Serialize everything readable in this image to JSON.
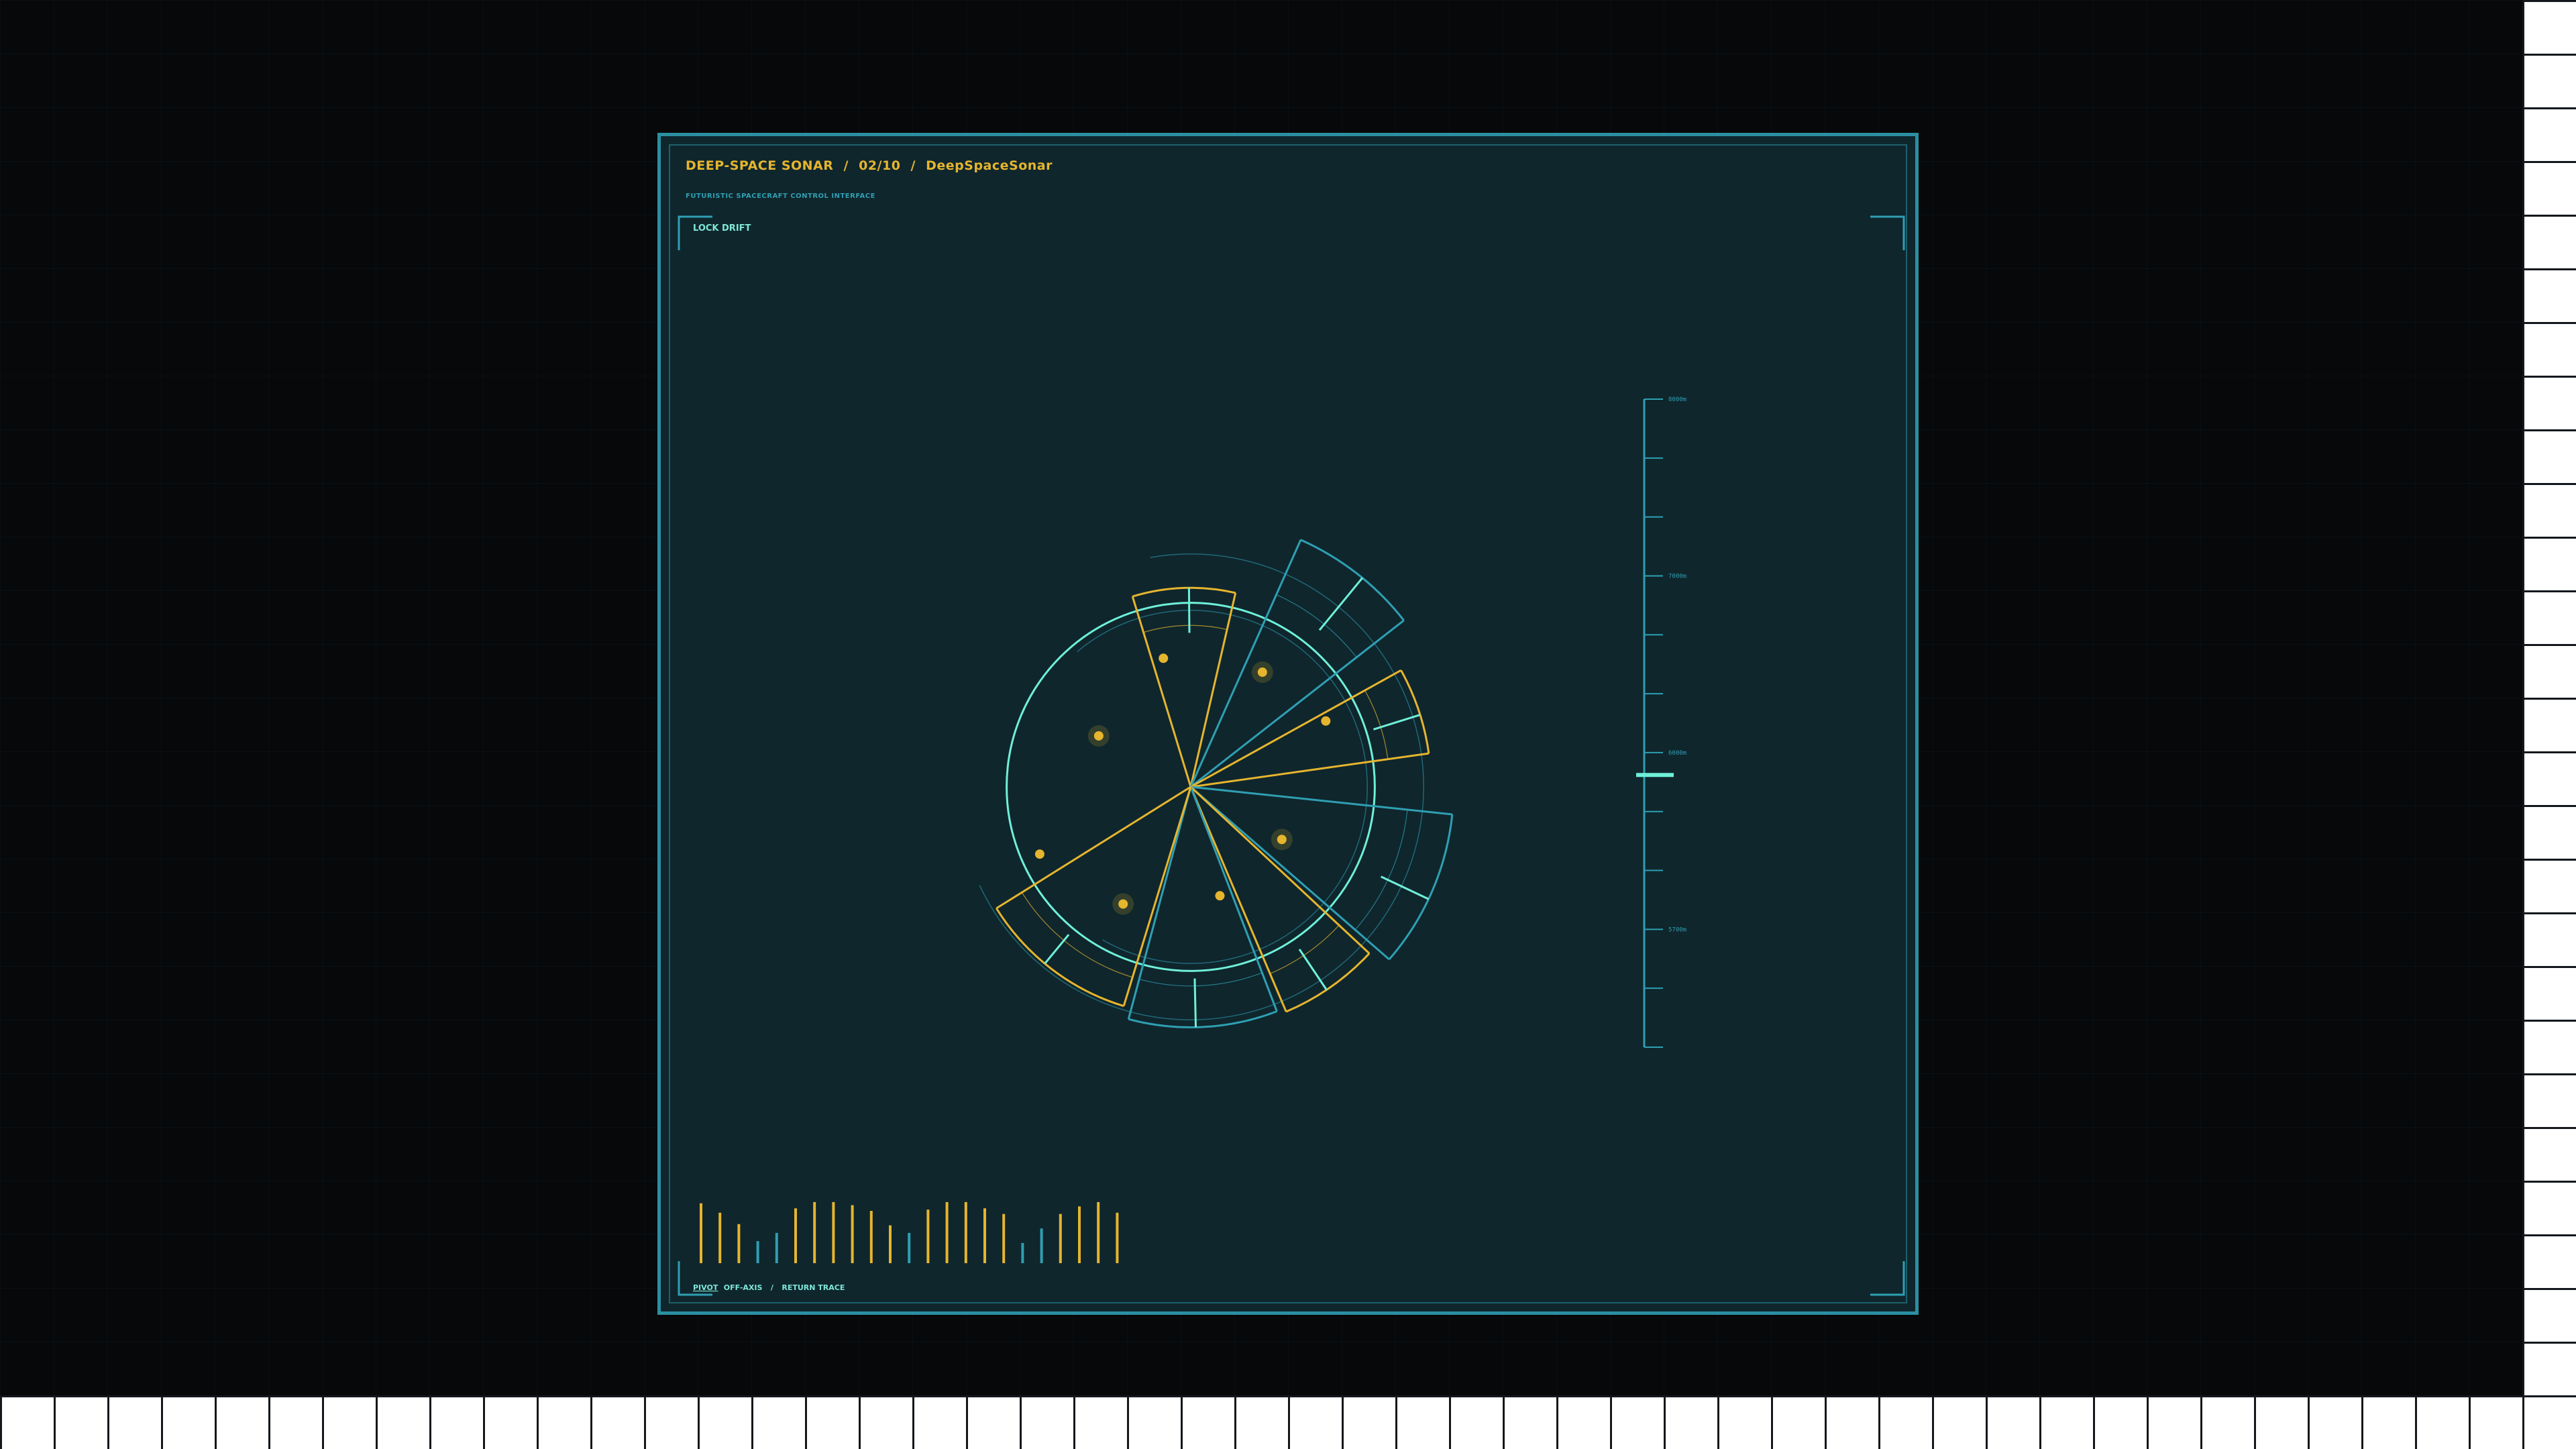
{
  "header": {
    "app": "DEEP-SPACE SONAR",
    "sep1": "/",
    "index": "02/10",
    "sep2": "/",
    "module": "DeepSpaceSonar",
    "subtitle": "FUTURISTIC SPACECRAFT CONTROL INTERFACE"
  },
  "controls": {
    "lock_drift": "LOCK DRIFT",
    "pivot": "PIVOT",
    "off_axis": "OFF-AXIS",
    "sep": "/",
    "return_trace": "RETURN TRACE"
  },
  "depth_scale": {
    "labels": [
      "8000m",
      "7000m",
      "6000m",
      "5700m"
    ],
    "marker_fraction": 0.58
  },
  "colors": {
    "cyan": "#6ff0d8",
    "teal": "#2f9fb2",
    "amber": "#e6b52e",
    "panel": "#0f262d"
  },
  "sonar": {
    "sectors": [
      {
        "from": -17,
        "to": 13,
        "inner": 0.41,
        "mid": 0.43,
        "outer": 0.53,
        "color": "amber"
      },
      {
        "from": 24,
        "to": 52,
        "inner": 0.54,
        "mid": 0.56,
        "outer": 0.72,
        "color": "teal"
      },
      {
        "from": 61,
        "to": 82,
        "inner": 0.51,
        "mid": 0.53,
        "outer": 0.64,
        "color": "amber"
      },
      {
        "from": 96,
        "to": 131,
        "inner": 0.56,
        "mid": 0.58,
        "outer": 0.7,
        "color": "teal"
      },
      {
        "from": 133,
        "to": 157,
        "inner": 0.52,
        "mid": 0.54,
        "outer": 0.65,
        "color": "amber"
      },
      {
        "from": 159,
        "to": 195,
        "inner": 0.51,
        "mid": 0.53,
        "outer": 0.64,
        "color": "teal"
      },
      {
        "from": 197,
        "to": 238,
        "inner": 0.51,
        "mid": 0.53,
        "outer": 0.61,
        "color": "amber"
      }
    ],
    "contacts": [
      {
        "angle": 348,
        "r": 0.35,
        "color": "amber",
        "glow": false
      },
      {
        "angle": 32,
        "r": 0.36,
        "color": "amber",
        "glow": true
      },
      {
        "angle": 64,
        "r": 0.4,
        "color": "amber",
        "glow": false
      },
      {
        "angle": 299,
        "r": 0.28,
        "color": "amber",
        "glow": true
      },
      {
        "angle": 120,
        "r": 0.28,
        "color": "amber",
        "glow": true
      },
      {
        "angle": 165,
        "r": 0.3,
        "color": "amber",
        "glow": false
      },
      {
        "angle": 210,
        "r": 0.36,
        "color": "amber",
        "glow": true
      },
      {
        "angle": 246,
        "r": 0.44,
        "color": "amber",
        "glow": false
      }
    ]
  },
  "spectrum": {
    "bars": [
      {
        "v": 0.95,
        "c": "amber"
      },
      {
        "v": 0.8,
        "c": "amber"
      },
      {
        "v": 0.62,
        "c": "amber"
      },
      {
        "v": 0.35,
        "c": "teal"
      },
      {
        "v": 0.48,
        "c": "teal"
      },
      {
        "v": 0.87,
        "c": "amber"
      },
      {
        "v": 0.97,
        "c": "amber"
      },
      {
        "v": 0.97,
        "c": "amber"
      },
      {
        "v": 0.92,
        "c": "amber"
      },
      {
        "v": 0.83,
        "c": "amber"
      },
      {
        "v": 0.6,
        "c": "amber"
      },
      {
        "v": 0.48,
        "c": "teal"
      },
      {
        "v": 0.85,
        "c": "amber"
      },
      {
        "v": 0.97,
        "c": "amber"
      },
      {
        "v": 0.97,
        "c": "amber"
      },
      {
        "v": 0.87,
        "c": "amber"
      },
      {
        "v": 0.78,
        "c": "amber"
      },
      {
        "v": 0.32,
        "c": "teal"
      },
      {
        "v": 0.55,
        "c": "teal"
      },
      {
        "v": 0.78,
        "c": "amber"
      },
      {
        "v": 0.9,
        "c": "amber"
      },
      {
        "v": 0.97,
        "c": "amber"
      },
      {
        "v": 0.8,
        "c": "amber"
      }
    ]
  }
}
